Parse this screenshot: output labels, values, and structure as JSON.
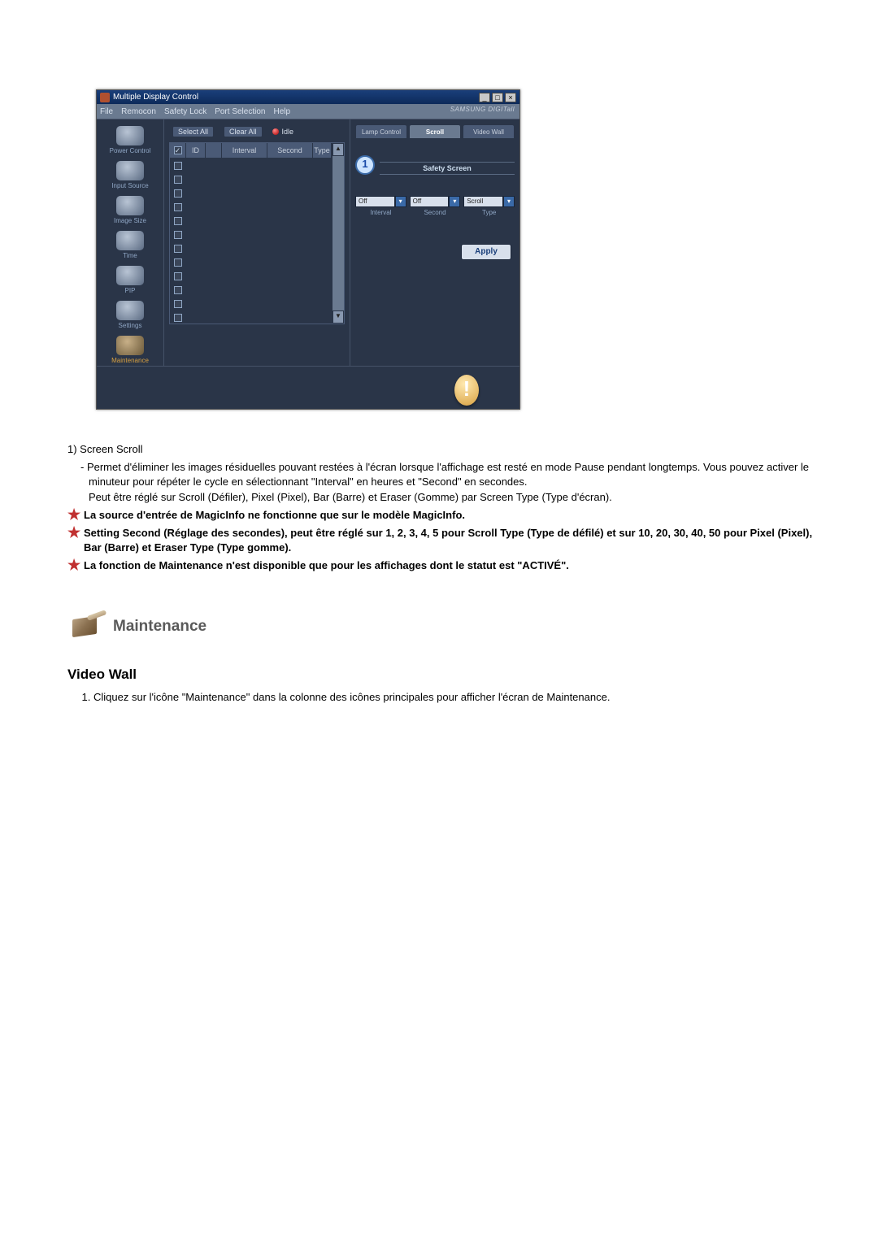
{
  "app": {
    "title": "Multiple Display Control",
    "brand": "SAMSUNG DIGITall"
  },
  "menus": {
    "file": "File",
    "remocon": "Remocon",
    "safety": "Safety Lock",
    "port": "Port Selection",
    "help": "Help"
  },
  "sidebar": {
    "items": [
      {
        "label": "Power Control"
      },
      {
        "label": "Input Source"
      },
      {
        "label": "Image Size"
      },
      {
        "label": "Time"
      },
      {
        "label": "PIP"
      },
      {
        "label": "Settings"
      },
      {
        "label": "Maintenance"
      }
    ]
  },
  "toolbar": {
    "select_all": "Select All",
    "clear_all": "Clear All",
    "idle": "Idle"
  },
  "grid": {
    "headers": {
      "id": "ID",
      "interval": "Interval",
      "second": "Second",
      "type": "Type"
    }
  },
  "right": {
    "tabs": {
      "lamp": "Lamp Control",
      "scroll": "Scroll",
      "video": "Video Wall"
    },
    "badge": "1",
    "safety_title": "Safety Screen",
    "dropdowns": {
      "interval_val": "Off",
      "second_val": "Off",
      "type_val": "Scroll",
      "interval_lbl": "Interval",
      "second_lbl": "Second",
      "type_lbl": "Type"
    },
    "apply": "Apply"
  },
  "winbtns": {
    "min": "_",
    "max": "□",
    "close": "×"
  },
  "text": {
    "n1": "1)  Screen Scroll",
    "n1a": "- Permet d'éliminer les images résiduelles pouvant restées à l'écran lorsque l'affichage est resté en mode Pause pendant longtemps. Vous pouvez activer le minuteur pour répéter le cycle en sélectionnant \"Interval\" en heures et \"Second\" en secondes.",
    "n1b": "Peut être réglé sur Scroll (Défiler), Pixel (Pixel), Bar (Barre) et Eraser (Gomme) par Screen Type (Type d'écran).",
    "s1": "La source d'entrée de MagicInfo ne fonctionne que sur le modèle MagicInfo.",
    "s2": "Setting Second (Réglage des secondes), peut être réglé sur 1, 2, 3, 4, 5 pour Scroll Type (Type de défilé) et sur 10, 20, 30, 40, 50 pour Pixel (Pixel), Bar (Barre) et Eraser Type (Type gomme).",
    "s3": "La fonction de Maintenance n'est disponible que pour les affichages dont le statut est \"ACTIVÉ\".",
    "section": "Maintenance",
    "sub": "Video Wall",
    "ol1": "Cliquez sur l'icône \"Maintenance\" dans la colonne des icônes principales pour afficher l'écran de Maintenance."
  }
}
